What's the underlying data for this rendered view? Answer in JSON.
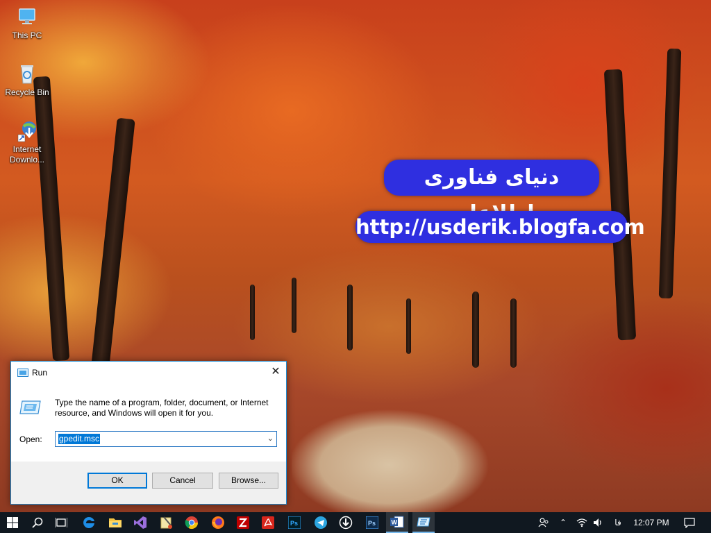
{
  "desktop": {
    "icons": [
      {
        "label": "This PC",
        "icon": "this-pc-icon"
      },
      {
        "label": "Recycle Bin",
        "icon": "recycle-bin-icon"
      },
      {
        "label": "Internet\nDownlo...",
        "line1": "Internet",
        "line2": "Downlo...",
        "icon": "internet-download-manager-icon"
      }
    ]
  },
  "wallpaper": {
    "overlay_line1": "دنیای فناوری اطلاعات",
    "overlay_line2": "http://usderik.blogfa.com"
  },
  "run_dialog": {
    "title": "Run",
    "description": "Type the name of a program, folder, document, or Internet resource, and Windows will open it for you.",
    "open_label": "Open:",
    "open_value": "gpedit.msc",
    "ok_label": "OK",
    "cancel_label": "Cancel",
    "browse_label": "Browse..."
  },
  "taskbar": {
    "apps": [
      "start-icon",
      "search-icon",
      "task-view-icon",
      "edge-icon",
      "file-explorer-icon",
      "visual-studio-icon",
      "app-icon",
      "chrome-icon",
      "firefox-icon",
      "filezilla-icon",
      "acrobat-icon",
      "photoshop-icon",
      "telegram-icon",
      "download-manager-icon",
      "photoshop-alt-icon",
      "word-icon",
      "run-icon"
    ],
    "tray": {
      "language": "فا",
      "time": "12:07 PM"
    }
  },
  "colors": {
    "taskbar_bg": "#101820",
    "accent": "#0078d7",
    "banner_bg": "#2f2fe0"
  }
}
